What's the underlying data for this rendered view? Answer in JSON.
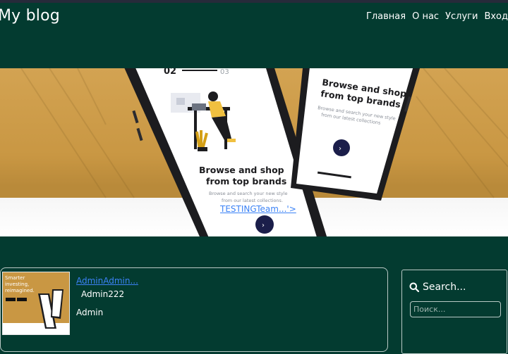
{
  "header": {
    "brand": "My blog",
    "nav": [
      "Главная",
      "О нас",
      "Услуги",
      "Вход"
    ]
  },
  "hero": {
    "caption_link": "TESTINGTeam...'>",
    "phone_left": {
      "step_current": "02",
      "step_total": "03",
      "headline_1": "Browse and shop",
      "headline_2": "from top brands",
      "sub_1": "Browse and search your new style",
      "sub_2": "from our latest collections."
    },
    "phone_right": {
      "headline_1": "Browse and shop",
      "headline_2": "from top brands",
      "sub_1": "Browse and search your new style",
      "sub_2": "from our latest collections"
    }
  },
  "post": {
    "title": "AdminAdmin...",
    "subtitle": "Admin222",
    "author": "Admin",
    "thumb_lines": [
      "Smarter",
      "investing,",
      "reimagined."
    ]
  },
  "sidebar": {
    "search_title": "Search...",
    "search_placeholder": "Поиск..."
  },
  "colors": {
    "background": "#033b30",
    "link": "#3b82f6",
    "hero_gold": "#c99743"
  }
}
